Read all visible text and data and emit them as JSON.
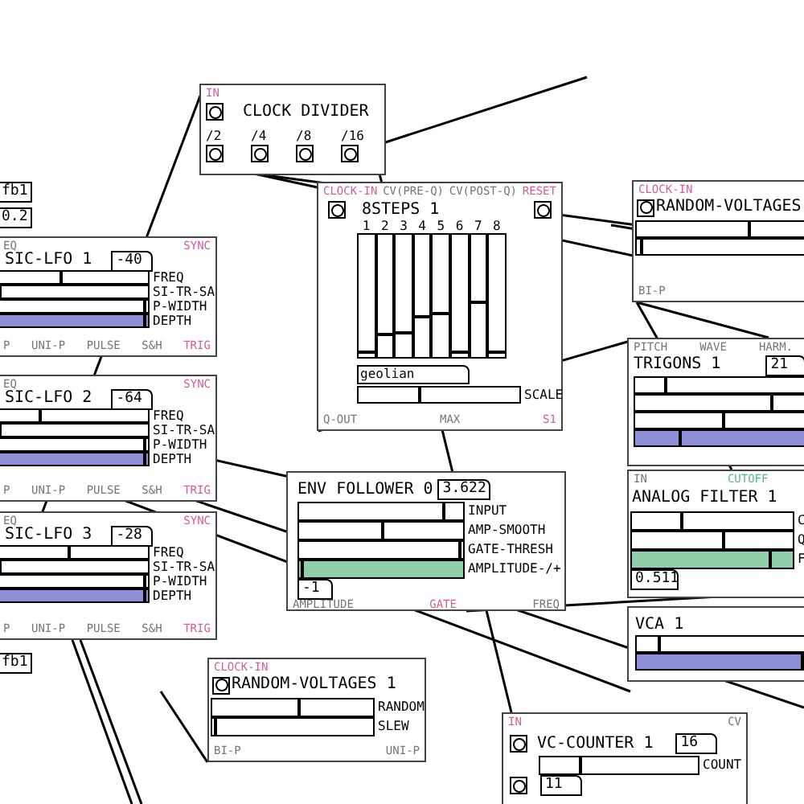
{
  "atoms": [
    {
      "text": "fb1"
    },
    {
      "text": "0.2"
    },
    {
      "text": "fb1"
    }
  ],
  "modules": [
    {
      "kind": "divider",
      "title": "CLOCK DIVIDER",
      "top_labels": [
        {
          "text": "IN",
          "color": "#d4609a"
        }
      ],
      "outputs": [
        {
          "text": "/2"
        },
        {
          "text": "/4"
        },
        {
          "text": "/8"
        },
        {
          "text": "/16"
        }
      ]
    },
    {
      "kind": "steps",
      "title": "8STEPS 1",
      "top_labels": [
        {
          "text": "CLOCK-IN",
          "color": "#d4609a"
        },
        {
          "text": "CV(PRE-Q)",
          "color": "#777777"
        },
        {
          "text": "CV(POST-Q)",
          "color": "#777777"
        },
        {
          "text": "RESET",
          "color": "#d4609a"
        }
      ],
      "steps": [
        {
          "text": "1",
          "level": 0.03
        },
        {
          "text": "2",
          "level": 0.17
        },
        {
          "text": "3",
          "level": 0.19
        },
        {
          "text": "4",
          "level": 0.32
        },
        {
          "text": "5",
          "level": 0.34
        },
        {
          "text": "6",
          "level": 0.03
        },
        {
          "text": "7",
          "level": 0.43
        },
        {
          "text": "8",
          "level": 0.03
        }
      ],
      "scale_name": "geolian",
      "sliders": [
        {
          "label": "SCALE",
          "level": 0.38
        }
      ],
      "bottom_labels": [
        {
          "text": "Q-OUT",
          "color": "#777777"
        },
        {
          "text": "MAX",
          "color": "#777777"
        },
        {
          "text": "S1",
          "color": "#d4609a"
        }
      ]
    },
    {
      "kind": "random",
      "title": "RANDOM-VOLTAGES",
      "top_labels": [
        {
          "text": "CLOCK-IN",
          "color": "#d4609a"
        }
      ],
      "sliders": [
        {
          "level": 0.65
        },
        {
          "level": 0.03
        }
      ],
      "bottom_labels": [
        {
          "text": "BI-P",
          "color": "#777777"
        }
      ]
    },
    {
      "kind": "lfo",
      "title": "SIC-LFO 1",
      "number": "-40",
      "top_labels": [
        {
          "text": "EQ",
          "color": "#777777"
        },
        {
          "text": "SYNC",
          "color": "#d4609a"
        }
      ],
      "sliders": [
        {
          "label": "FREQ",
          "level": 0.41
        },
        {
          "label": "SI-TR-SA",
          "level": 0.0
        },
        {
          "label": "P-WIDTH",
          "level": 0.98
        },
        {
          "label": "DEPTH",
          "level": 0.98,
          "color": "#8f8fd8"
        }
      ],
      "bottom_labels": [
        {
          "text": "P",
          "color": "#777777"
        },
        {
          "text": "UNI-P",
          "color": "#777777"
        },
        {
          "text": "PULSE",
          "color": "#777777"
        },
        {
          "text": "S&H",
          "color": "#777777"
        },
        {
          "text": "TRIG",
          "color": "#d4609a"
        }
      ]
    },
    {
      "kind": "lfo",
      "title": "SIC-LFO 2",
      "number": "-64",
      "top_labels": [
        {
          "text": "EQ",
          "color": "#777777"
        },
        {
          "text": "SYNC",
          "color": "#d4609a"
        }
      ],
      "sliders": [
        {
          "label": "FREQ",
          "level": 0.27
        },
        {
          "label": "SI-TR-SA",
          "level": 0.0
        },
        {
          "label": "P-WIDTH",
          "level": 0.98
        },
        {
          "label": "DEPTH",
          "level": 0.98,
          "color": "#8f8fd8"
        }
      ],
      "bottom_labels": [
        {
          "text": "P",
          "color": "#777777"
        },
        {
          "text": "UNI-P",
          "color": "#777777"
        },
        {
          "text": "PULSE",
          "color": "#777777"
        },
        {
          "text": "S&H",
          "color": "#777777"
        },
        {
          "text": "TRIG",
          "color": "#d4609a"
        }
      ]
    },
    {
      "kind": "trigons",
      "title": "TRIGONS 1",
      "number": "21",
      "top_labels": [
        {
          "text": "PITCH",
          "color": "#777777"
        },
        {
          "text": "WAVE",
          "color": "#777777"
        },
        {
          "text": "HARM.",
          "color": "#777777"
        }
      ],
      "sliders": [
        {
          "level": 0.17
        },
        {
          "level": 0.77
        },
        {
          "level": 0.5
        },
        {
          "level": 0.25,
          "color": "#8f8fd8"
        }
      ]
    },
    {
      "kind": "env",
      "title": "ENV FOLLOWER 0",
      "number": "3.622",
      "sliders": [
        {
          "label": "INPUT",
          "level": 0.88
        },
        {
          "label": "AMP-SMOOTH",
          "level": 0.51
        },
        {
          "label": "GATE-THRESH",
          "level": 0.98
        },
        {
          "label": "AMPLITUDE-/+",
          "level": 0.02,
          "color": "#8fd0aa"
        }
      ],
      "number_2": "-1",
      "bottom_labels": [
        {
          "text": "AMPLITUDE",
          "color": "#777777"
        },
        {
          "text": "GATE",
          "color": "#d4609a"
        },
        {
          "text": "FREQ",
          "color": "#777777"
        }
      ]
    },
    {
      "kind": "filter",
      "title": "ANALOG FILTER 1",
      "top_labels": [
        {
          "text": "IN",
          "color": "#777777"
        },
        {
          "text": "CUTOFF",
          "color": "#5cb88a"
        }
      ],
      "sliders": [
        {
          "label": "C",
          "level": 0.31
        },
        {
          "label": "Q",
          "level": 0.57
        },
        {
          "label": "F",
          "level": 0.86,
          "color": "#8fd0aa"
        }
      ],
      "number_2": "0.511"
    },
    {
      "kind": "lfo",
      "title": "SIC-LFO 3",
      "number": "-28",
      "top_labels": [
        {
          "text": "EQ",
          "color": "#777777"
        },
        {
          "text": "SYNC",
          "color": "#d4609a"
        }
      ],
      "sliders": [
        {
          "label": "FREQ",
          "level": 0.47
        },
        {
          "label": "SI-TR-SA",
          "level": 0.0
        },
        {
          "label": "P-WIDTH",
          "level": 0.98
        },
        {
          "label": "DEPTH",
          "level": 0.98,
          "color": "#8f8fd8"
        }
      ],
      "bottom_labels": [
        {
          "text": "P",
          "color": "#777777"
        },
        {
          "text": "UNI-P",
          "color": "#777777"
        },
        {
          "text": "PULSE",
          "color": "#777777"
        },
        {
          "text": "S&H",
          "color": "#777777"
        },
        {
          "text": "TRIG",
          "color": "#d4609a"
        }
      ]
    },
    {
      "kind": "vca",
      "title": "VCA 1",
      "sliders": [
        {
          "level": 0.13
        },
        {
          "level": 0.99,
          "color": "#8f8fd8"
        }
      ]
    },
    {
      "kind": "random",
      "title": "RANDOM-VOLTAGES 1",
      "top_labels": [
        {
          "text": "CLOCK-IN",
          "color": "#d4609a"
        }
      ],
      "sliders": [
        {
          "label": "RANDOM",
          "level": 0.54
        },
        {
          "label": "SLEW",
          "level": 0.02
        }
      ],
      "bottom_labels": [
        {
          "text": "BI-P",
          "color": "#777777"
        },
        {
          "text": "UNI-P",
          "color": "#777777"
        }
      ]
    },
    {
      "kind": "counter",
      "title": "VC-COUNTER 1",
      "number": "16",
      "top_labels": [
        {
          "text": "IN",
          "color": "#d4609a"
        },
        {
          "text": "CV",
          "color": "#777777"
        }
      ],
      "sliders": [
        {
          "label": "COUNT",
          "level": 0.26
        }
      ],
      "number_2": "11"
    }
  ]
}
